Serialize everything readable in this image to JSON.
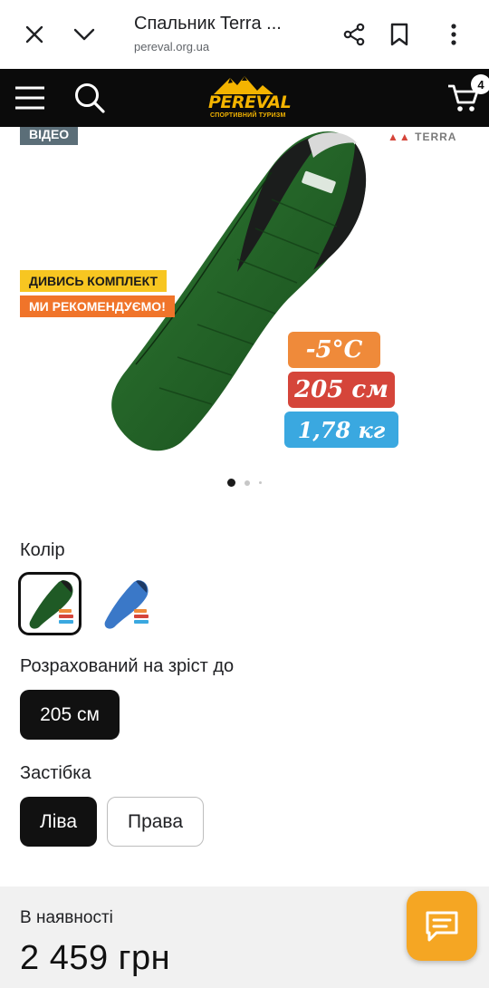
{
  "browser": {
    "tab_title": "Спальник Terra ...",
    "url": "pereval.org.ua"
  },
  "site": {
    "logo_text": "PEREVAL",
    "logo_subtitle": "СПОРТИВНИЙ ТУРИЗМ",
    "cart_count": "4"
  },
  "hero": {
    "tag_video": "ВІДЕО",
    "tag_kit": "ДИВИСЬ КОМПЛЕКТ",
    "tag_recommend": "МИ РЕКОМЕНДУЄМО!",
    "brand": "TERRA",
    "spec_temp": "-5°C",
    "spec_length": "205 см",
    "spec_weight": "1,78 кг",
    "slide_count": 3,
    "active_slide": 0
  },
  "options": {
    "color_label": "Колір",
    "colors": [
      {
        "name": "green",
        "hex": "#1f5a25",
        "selected": true
      },
      {
        "name": "blue",
        "hex": "#3a78c8",
        "selected": false
      }
    ],
    "height_label": "Розрахований на зріст до",
    "height_value": "205 см",
    "zipper_label": "Застібка",
    "zipper_left": "Ліва",
    "zipper_right": "Права"
  },
  "purchase": {
    "availability": "В наявності",
    "price": "2 459 грн"
  },
  "colors": {
    "header_bg": "#0b0b0b",
    "accent_yellow": "#f4b400",
    "chat_orange": "#f5a623"
  }
}
